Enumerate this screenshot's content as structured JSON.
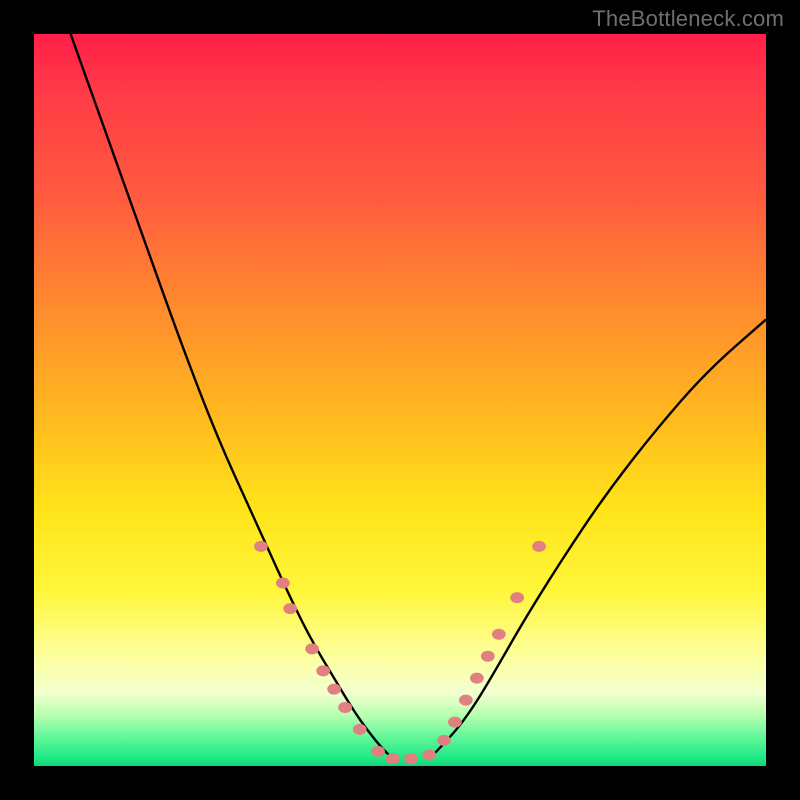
{
  "watermark": "TheBottleneck.com",
  "chart_data": {
    "type": "line",
    "title": "",
    "xlabel": "",
    "ylabel": "",
    "xlim": [
      0,
      100
    ],
    "ylim": [
      0,
      100
    ],
    "grid": false,
    "legend": false,
    "annotations": [],
    "series": [
      {
        "name": "left-branch",
        "x": [
          5,
          10,
          15,
          20,
          25,
          30,
          35,
          38,
          41,
          44,
          47,
          49
        ],
        "y": [
          100,
          86,
          72,
          58,
          45,
          34,
          23,
          17,
          12,
          7,
          3,
          1
        ]
      },
      {
        "name": "right-branch",
        "x": [
          54,
          57,
          60,
          63,
          67,
          72,
          78,
          85,
          92,
          100
        ],
        "y": [
          1,
          4,
          8,
          13,
          20,
          28,
          37,
          46,
          54,
          61
        ]
      }
    ],
    "markers": [
      {
        "x": 31,
        "y": 30
      },
      {
        "x": 34,
        "y": 25
      },
      {
        "x": 35,
        "y": 21.5
      },
      {
        "x": 38,
        "y": 16
      },
      {
        "x": 39.5,
        "y": 13
      },
      {
        "x": 41,
        "y": 10.5
      },
      {
        "x": 42.5,
        "y": 8
      },
      {
        "x": 44.5,
        "y": 5
      },
      {
        "x": 47,
        "y": 2
      },
      {
        "x": 49,
        "y": 1
      },
      {
        "x": 51.5,
        "y": 1
      },
      {
        "x": 54,
        "y": 1.5
      },
      {
        "x": 56,
        "y": 3.5
      },
      {
        "x": 57.5,
        "y": 6
      },
      {
        "x": 59,
        "y": 9
      },
      {
        "x": 60.5,
        "y": 12
      },
      {
        "x": 62,
        "y": 15
      },
      {
        "x": 63.5,
        "y": 18
      },
      {
        "x": 66,
        "y": 23
      },
      {
        "x": 69,
        "y": 30
      }
    ],
    "marker_color": "#e08080",
    "marker_size_px": 11,
    "line_color": "#000000"
  }
}
